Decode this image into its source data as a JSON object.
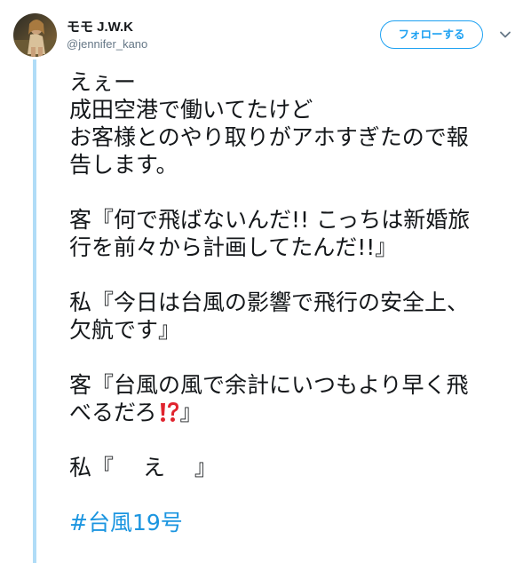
{
  "user": {
    "display_name": "モモ J.W.K",
    "handle": "@jennifer_kano"
  },
  "actions": {
    "follow_label": "フォローする"
  },
  "icons": {
    "menu": "chevron-down-icon",
    "emoji": "interrobang-icon"
  },
  "colors": {
    "accent": "#1da1f2",
    "hashtag": "#1b95e0",
    "thread_line": "#b0dcf7",
    "text": "#14171a",
    "secondary": "#657786",
    "emoji_red": "#e0242e"
  },
  "tweet": {
    "lines": {
      "l1": "えぇー",
      "l2": "成田空港で働いてたけど",
      "l3": "お客様とのやり取りがアホすぎたので報",
      "l4": "告します。",
      "l5": "客『何で飛ばないんだ!! こっちは新婚旅",
      "l6": "行を前々から計画してたんだ!!』",
      "l7": "私『今日は台風の影響で飛行の安全上、",
      "l8": "欠航です』",
      "l9": "客『台風の風で余計にいつもより早く飛",
      "l10a": "べるだろ",
      "l10b": "』",
      "l11": "私『　 え 　』"
    },
    "hashtag": "#台風19号"
  }
}
